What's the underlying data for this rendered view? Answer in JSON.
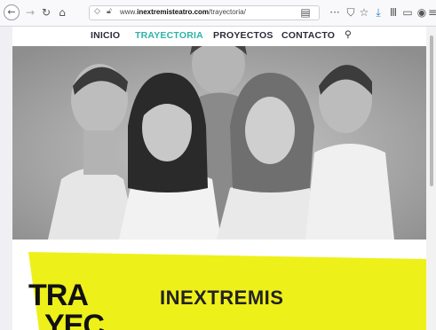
{
  "browser": {
    "url_prefix": "www.",
    "url_domain": "inextremisteatro.com",
    "url_path": "/trayectoria/",
    "icons": [
      "back-arrow-icon",
      "forward-arrow-icon",
      "reload-icon",
      "home-icon",
      "shield-icon",
      "lock-slash-icon",
      "reader-icon",
      "more-icon",
      "pocket-icon",
      "bookmark-star-icon",
      "download-icon",
      "library-icon",
      "sidebar-icon",
      "account-icon",
      "menu-icon"
    ]
  },
  "nav": {
    "items": [
      {
        "label": "INICIO"
      },
      {
        "label": "TRAYECTORIA"
      },
      {
        "label": "PROYECTOS"
      },
      {
        "label": "CONTACTO"
      }
    ],
    "active_color": "#2fb3a6",
    "text_color": "#2c2c3a"
  },
  "section": {
    "big_line1": "TRA",
    "big_line2": "YEC",
    "brand": "INEXTREMIS",
    "accent_color": "#eef01a"
  }
}
